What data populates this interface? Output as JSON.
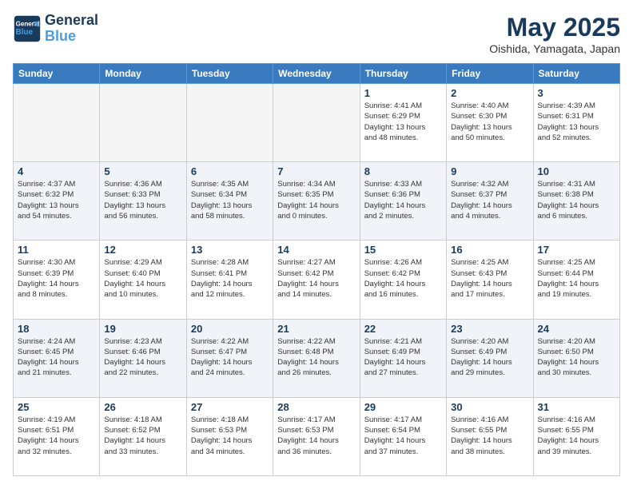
{
  "header": {
    "logo_line1": "General",
    "logo_line2": "Blue",
    "month_year": "May 2025",
    "location": "Oishida, Yamagata, Japan"
  },
  "weekdays": [
    "Sunday",
    "Monday",
    "Tuesday",
    "Wednesday",
    "Thursday",
    "Friday",
    "Saturday"
  ],
  "weeks": [
    [
      {
        "day": "",
        "info": ""
      },
      {
        "day": "",
        "info": ""
      },
      {
        "day": "",
        "info": ""
      },
      {
        "day": "",
        "info": ""
      },
      {
        "day": "1",
        "info": "Sunrise: 4:41 AM\nSunset: 6:29 PM\nDaylight: 13 hours\nand 48 minutes."
      },
      {
        "day": "2",
        "info": "Sunrise: 4:40 AM\nSunset: 6:30 PM\nDaylight: 13 hours\nand 50 minutes."
      },
      {
        "day": "3",
        "info": "Sunrise: 4:39 AM\nSunset: 6:31 PM\nDaylight: 13 hours\nand 52 minutes."
      }
    ],
    [
      {
        "day": "4",
        "info": "Sunrise: 4:37 AM\nSunset: 6:32 PM\nDaylight: 13 hours\nand 54 minutes."
      },
      {
        "day": "5",
        "info": "Sunrise: 4:36 AM\nSunset: 6:33 PM\nDaylight: 13 hours\nand 56 minutes."
      },
      {
        "day": "6",
        "info": "Sunrise: 4:35 AM\nSunset: 6:34 PM\nDaylight: 13 hours\nand 58 minutes."
      },
      {
        "day": "7",
        "info": "Sunrise: 4:34 AM\nSunset: 6:35 PM\nDaylight: 14 hours\nand 0 minutes."
      },
      {
        "day": "8",
        "info": "Sunrise: 4:33 AM\nSunset: 6:36 PM\nDaylight: 14 hours\nand 2 minutes."
      },
      {
        "day": "9",
        "info": "Sunrise: 4:32 AM\nSunset: 6:37 PM\nDaylight: 14 hours\nand 4 minutes."
      },
      {
        "day": "10",
        "info": "Sunrise: 4:31 AM\nSunset: 6:38 PM\nDaylight: 14 hours\nand 6 minutes."
      }
    ],
    [
      {
        "day": "11",
        "info": "Sunrise: 4:30 AM\nSunset: 6:39 PM\nDaylight: 14 hours\nand 8 minutes."
      },
      {
        "day": "12",
        "info": "Sunrise: 4:29 AM\nSunset: 6:40 PM\nDaylight: 14 hours\nand 10 minutes."
      },
      {
        "day": "13",
        "info": "Sunrise: 4:28 AM\nSunset: 6:41 PM\nDaylight: 14 hours\nand 12 minutes."
      },
      {
        "day": "14",
        "info": "Sunrise: 4:27 AM\nSunset: 6:42 PM\nDaylight: 14 hours\nand 14 minutes."
      },
      {
        "day": "15",
        "info": "Sunrise: 4:26 AM\nSunset: 6:42 PM\nDaylight: 14 hours\nand 16 minutes."
      },
      {
        "day": "16",
        "info": "Sunrise: 4:25 AM\nSunset: 6:43 PM\nDaylight: 14 hours\nand 17 minutes."
      },
      {
        "day": "17",
        "info": "Sunrise: 4:25 AM\nSunset: 6:44 PM\nDaylight: 14 hours\nand 19 minutes."
      }
    ],
    [
      {
        "day": "18",
        "info": "Sunrise: 4:24 AM\nSunset: 6:45 PM\nDaylight: 14 hours\nand 21 minutes."
      },
      {
        "day": "19",
        "info": "Sunrise: 4:23 AM\nSunset: 6:46 PM\nDaylight: 14 hours\nand 22 minutes."
      },
      {
        "day": "20",
        "info": "Sunrise: 4:22 AM\nSunset: 6:47 PM\nDaylight: 14 hours\nand 24 minutes."
      },
      {
        "day": "21",
        "info": "Sunrise: 4:22 AM\nSunset: 6:48 PM\nDaylight: 14 hours\nand 26 minutes."
      },
      {
        "day": "22",
        "info": "Sunrise: 4:21 AM\nSunset: 6:49 PM\nDaylight: 14 hours\nand 27 minutes."
      },
      {
        "day": "23",
        "info": "Sunrise: 4:20 AM\nSunset: 6:49 PM\nDaylight: 14 hours\nand 29 minutes."
      },
      {
        "day": "24",
        "info": "Sunrise: 4:20 AM\nSunset: 6:50 PM\nDaylight: 14 hours\nand 30 minutes."
      }
    ],
    [
      {
        "day": "25",
        "info": "Sunrise: 4:19 AM\nSunset: 6:51 PM\nDaylight: 14 hours\nand 32 minutes."
      },
      {
        "day": "26",
        "info": "Sunrise: 4:18 AM\nSunset: 6:52 PM\nDaylight: 14 hours\nand 33 minutes."
      },
      {
        "day": "27",
        "info": "Sunrise: 4:18 AM\nSunset: 6:53 PM\nDaylight: 14 hours\nand 34 minutes."
      },
      {
        "day": "28",
        "info": "Sunrise: 4:17 AM\nSunset: 6:53 PM\nDaylight: 14 hours\nand 36 minutes."
      },
      {
        "day": "29",
        "info": "Sunrise: 4:17 AM\nSunset: 6:54 PM\nDaylight: 14 hours\nand 37 minutes."
      },
      {
        "day": "30",
        "info": "Sunrise: 4:16 AM\nSunset: 6:55 PM\nDaylight: 14 hours\nand 38 minutes."
      },
      {
        "day": "31",
        "info": "Sunrise: 4:16 AM\nSunset: 6:55 PM\nDaylight: 14 hours\nand 39 minutes."
      }
    ]
  ]
}
